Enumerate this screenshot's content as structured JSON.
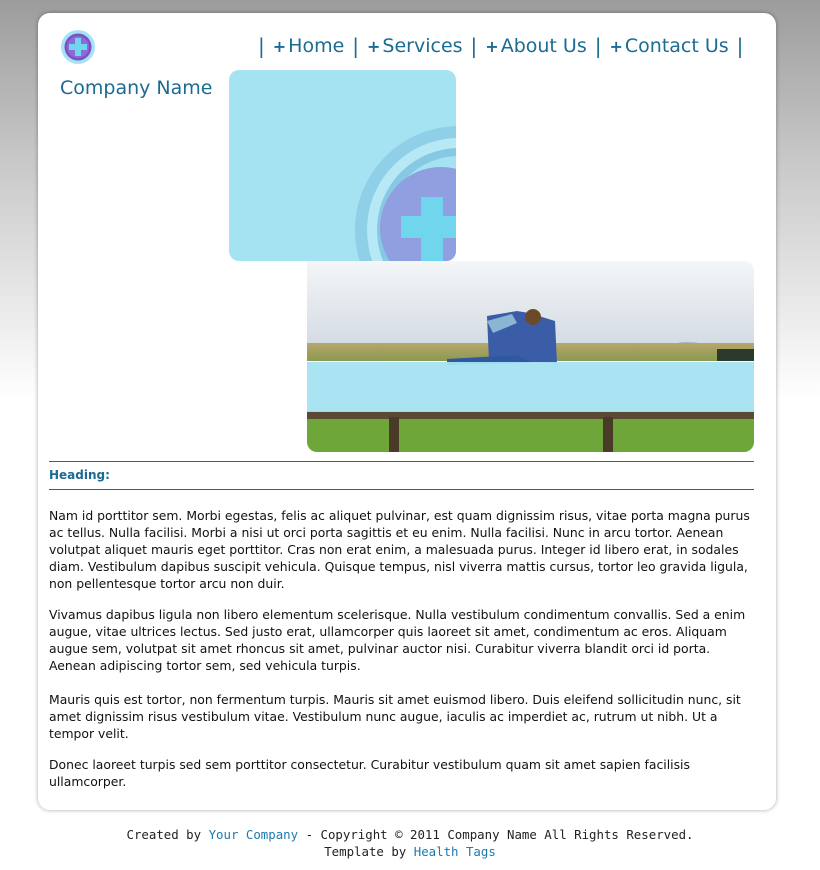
{
  "header": {
    "company_name": "Company Name",
    "logo_icon": "medical-cross-icon"
  },
  "nav": {
    "separator": "|",
    "plus": "+",
    "items": [
      {
        "label": "Home"
      },
      {
        "label": "Services"
      },
      {
        "label": "About Us"
      },
      {
        "label": "Contact Us"
      }
    ]
  },
  "colors": {
    "accent": "#1b6b93",
    "hero_box": "#a5e3f2",
    "link": "#1b7bb0"
  },
  "main": {
    "heading": "Heading:",
    "paragraphs": [
      "Nam id porttitor sem. Morbi egestas, felis ac aliquet pulvinar, est quam dignissim risus, vitae porta magna purus ac tellus. Nulla facilisi. Morbi a nisi ut orci porta sagittis et eu enim. Nulla facilisi. Nunc in arcu tortor. Aenean volutpat aliquet mauris eget porttitor. Cras non erat enim, a malesuada purus. Integer id libero erat, in sodales diam. Vestibulum dapibus suscipit vehicula. Quisque tempus, nisl viverra mattis cursus, tortor leo gravida ligula, non pellentesque tortor arcu non duir.",
      "Vivamus dapibus ligula non libero elementum scelerisque. Nulla vestibulum condimentum convallis. Sed a enim augue, vitae ultrices lectus. Sed justo erat, ullamcorper quis laoreet sit amet, condimentum ac eros. Aliquam augue sem, volutpat sit amet rhoncus sit amet, pulvinar auctor nisi. Curabitur viverra blandit orci id porta. Aenean adipiscing tortor sem, sed vehicula turpis.",
      "Mauris quis est tortor, non fermentum turpis. Mauris sit amet euismod libero. Duis eleifend sollicitudin nunc, sit amet dignissim risus vestibulum vitae. Vestibulum nunc augue, iaculis ac imperdiet ac, rutrum ut nibh. Ut a tempor velit.",
      "Donec laoreet turpis sed sem porttitor consectetur. Curabitur vestibulum quam sit amet sapien facilisis ullamcorper."
    ]
  },
  "footer": {
    "created_by": "Created by",
    "your_company": "Your Company",
    "copyright": "- Copyright © 2011 Company Name All Rights Reserved.",
    "template_by": "Template by",
    "health_tags": "Health Tags"
  }
}
